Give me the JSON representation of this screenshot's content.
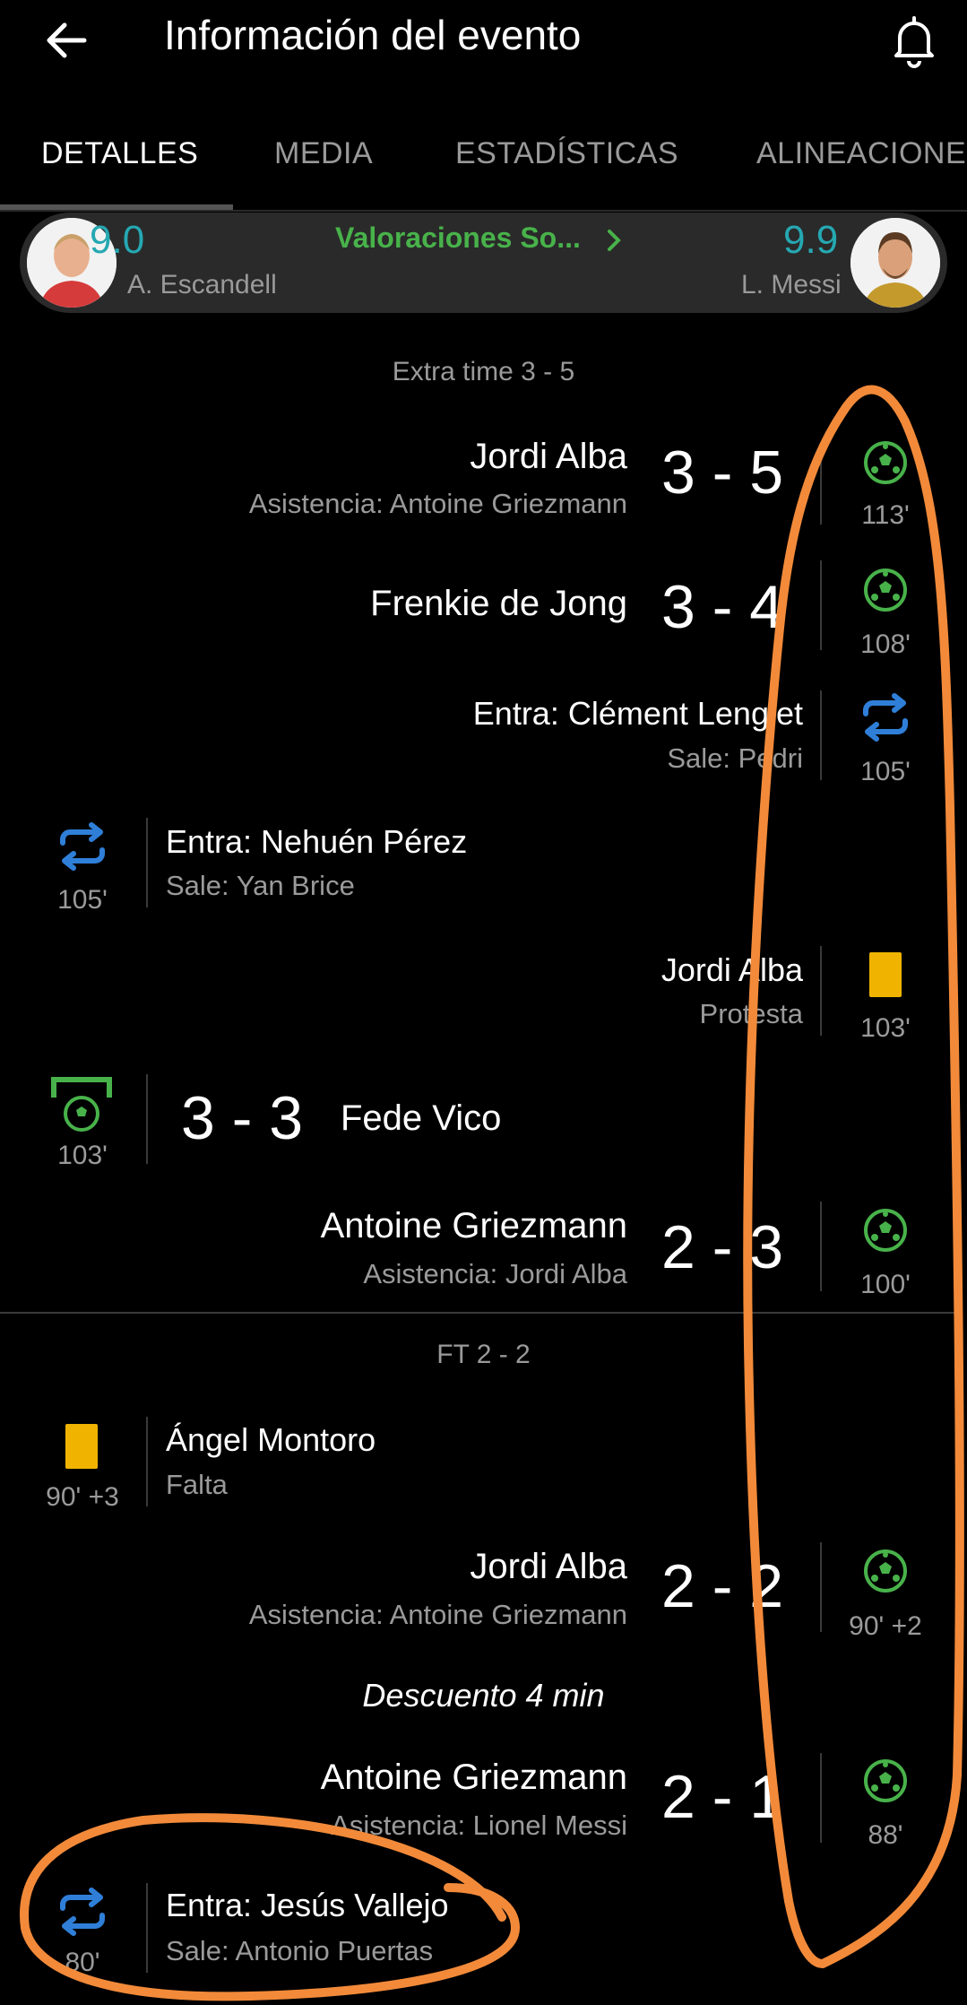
{
  "header": {
    "title": "Información del evento",
    "back_icon": "arrow-left-icon",
    "bell_icon": "bell-icon"
  },
  "tabs": [
    {
      "label": "DETALLES",
      "active": true
    },
    {
      "label": "MEDIA",
      "active": false
    },
    {
      "label": "ESTADÍSTICAS",
      "active": false
    },
    {
      "label": "ALINEACIONES",
      "active": false
    }
  ],
  "ratings": {
    "home": {
      "rating": "9.0",
      "name": "A. Escandell"
    },
    "link": "Valoraciones So...",
    "away": {
      "rating": "9.9",
      "name": "L. Messi"
    }
  },
  "sections": {
    "extra_time": "Extra time 3 - 5",
    "ft": "FT 2 - 2",
    "stoppage": "Descuento 4 min"
  },
  "events": {
    "e1": {
      "player": "Jordi Alba",
      "detail": "Asistencia: Antoine Griezmann",
      "score": "3 - 5",
      "minute": "113'",
      "type": "goal"
    },
    "e2": {
      "player": "Frenkie de Jong",
      "score": "3 - 4",
      "minute": "108'",
      "type": "goal"
    },
    "e3": {
      "player": "Entra: Clément Lenglet",
      "detail": "Sale: Pedri",
      "minute": "105'",
      "type": "substitution"
    },
    "e4": {
      "player": "Entra: Nehuén Pérez",
      "detail": "Sale: Yan Brice",
      "minute": "105'",
      "type": "substitution"
    },
    "e5": {
      "player": "Jordi Alba",
      "detail": "Protesta",
      "minute": "103'",
      "type": "yellow-card"
    },
    "e6": {
      "player": "Fede Vico",
      "score": "3 - 3",
      "minute": "103'",
      "type": "penalty-goal"
    },
    "e7": {
      "player": "Antoine Griezmann",
      "detail": "Asistencia: Jordi Alba",
      "score": "2 - 3",
      "minute": "100'",
      "type": "goal"
    },
    "e8": {
      "player": "Ángel Montoro",
      "detail": "Falta",
      "minute": "90' +3",
      "type": "yellow-card"
    },
    "e9": {
      "player": "Jordi Alba",
      "detail": "Asistencia: Antoine Griezmann",
      "score": "2 - 2",
      "minute": "90' +2",
      "type": "goal"
    },
    "e10": {
      "player": "Antoine Griezmann",
      "detail": "Asistencia: Lionel Messi",
      "score": "2 - 1",
      "minute": "88'",
      "type": "goal"
    },
    "e11": {
      "player": "Entra: Jesús Vallejo",
      "detail": "Sale: Antonio Puertas",
      "minute": "80'",
      "type": "substitution"
    }
  },
  "colors": {
    "background": "#000000",
    "goal_green": "#48b24a",
    "rating_teal": "#25a8b2",
    "sub_blue": "#2f7fd8",
    "yellow_card": "#f0b400",
    "annotation_orange": "#f28a3a"
  }
}
